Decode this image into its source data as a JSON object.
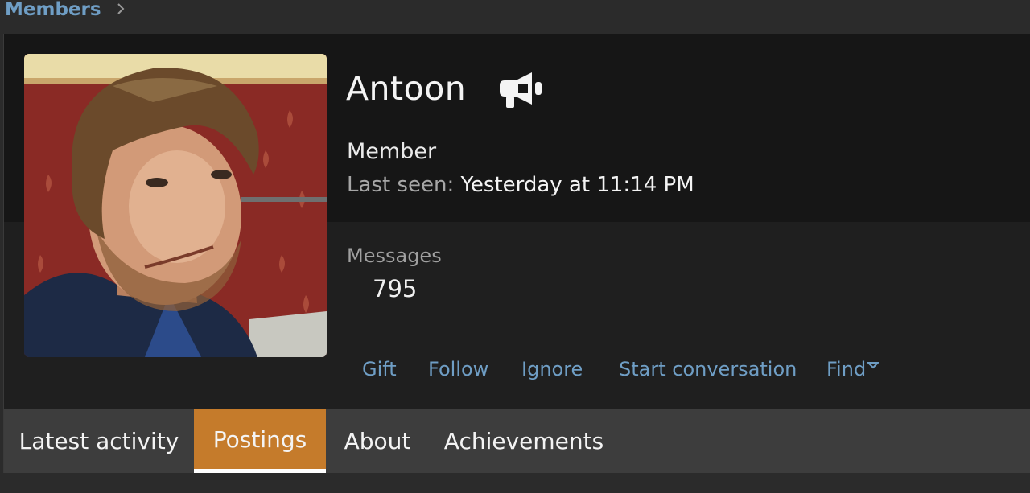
{
  "breadcrumb": {
    "members": "Members",
    "separator": ">"
  },
  "profile": {
    "username": "Antoon",
    "title": "Member",
    "last_seen_label": "Last seen:",
    "last_seen_value": "Yesterday at 11:14 PM",
    "messages_label": "Messages",
    "messages_value": "795",
    "icons": {
      "megaphone": "megaphone-icon",
      "avatar": "avatar-photo"
    }
  },
  "actions": {
    "gift": "Gift",
    "follow": "Follow",
    "ignore": "Ignore",
    "start_conversation": "Start conversation",
    "find": "Find"
  },
  "tabs": [
    {
      "label": "Latest activity",
      "active": false
    },
    {
      "label": "Postings",
      "active": true
    },
    {
      "label": "About",
      "active": false
    },
    {
      "label": "Achievements",
      "active": false
    }
  ],
  "colors": {
    "link": "#6f9ec5",
    "active_tab": "#c57b2b",
    "page_bg": "#2b2b2b",
    "card_top_bg": "#161616"
  }
}
